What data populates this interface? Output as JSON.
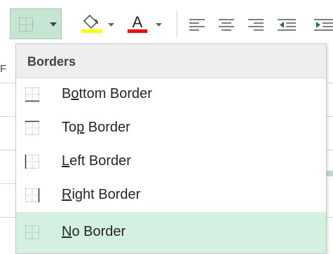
{
  "ribbon": {
    "borders_button": {
      "icon": "borders-icon",
      "dropdown_icon": "chevron-down-icon"
    },
    "fill_color_button": {
      "icon": "paint-bucket-icon",
      "color": "#ffff00"
    },
    "font_color_button": {
      "label": "A",
      "color": "#ff0000"
    },
    "alignment_icons": [
      "align-left-icon",
      "align-center-icon",
      "align-right-icon",
      "decrease-indent-icon"
    ],
    "accent_color": "#217346",
    "selected_button_bg": "#c6e6d3"
  },
  "sheet": {
    "left_fragment": "F"
  },
  "menu": {
    "header": "Borders",
    "items": [
      {
        "pre": "B",
        "accel": "o",
        "post": "ttom Border",
        "icon": "bottom-border-icon"
      },
      {
        "pre": "To",
        "accel": "p",
        "post": " Border",
        "icon": "top-border-icon"
      },
      {
        "pre": "",
        "accel": "L",
        "post": "eft Border",
        "icon": "left-border-icon"
      },
      {
        "pre": "",
        "accel": "R",
        "post": "ight Border",
        "icon": "right-border-icon"
      },
      {
        "pre": "",
        "accel": "N",
        "post": "o Border",
        "icon": "no-border-icon",
        "highlighted": true
      }
    ],
    "highlight_color": "#d3f0e0"
  }
}
